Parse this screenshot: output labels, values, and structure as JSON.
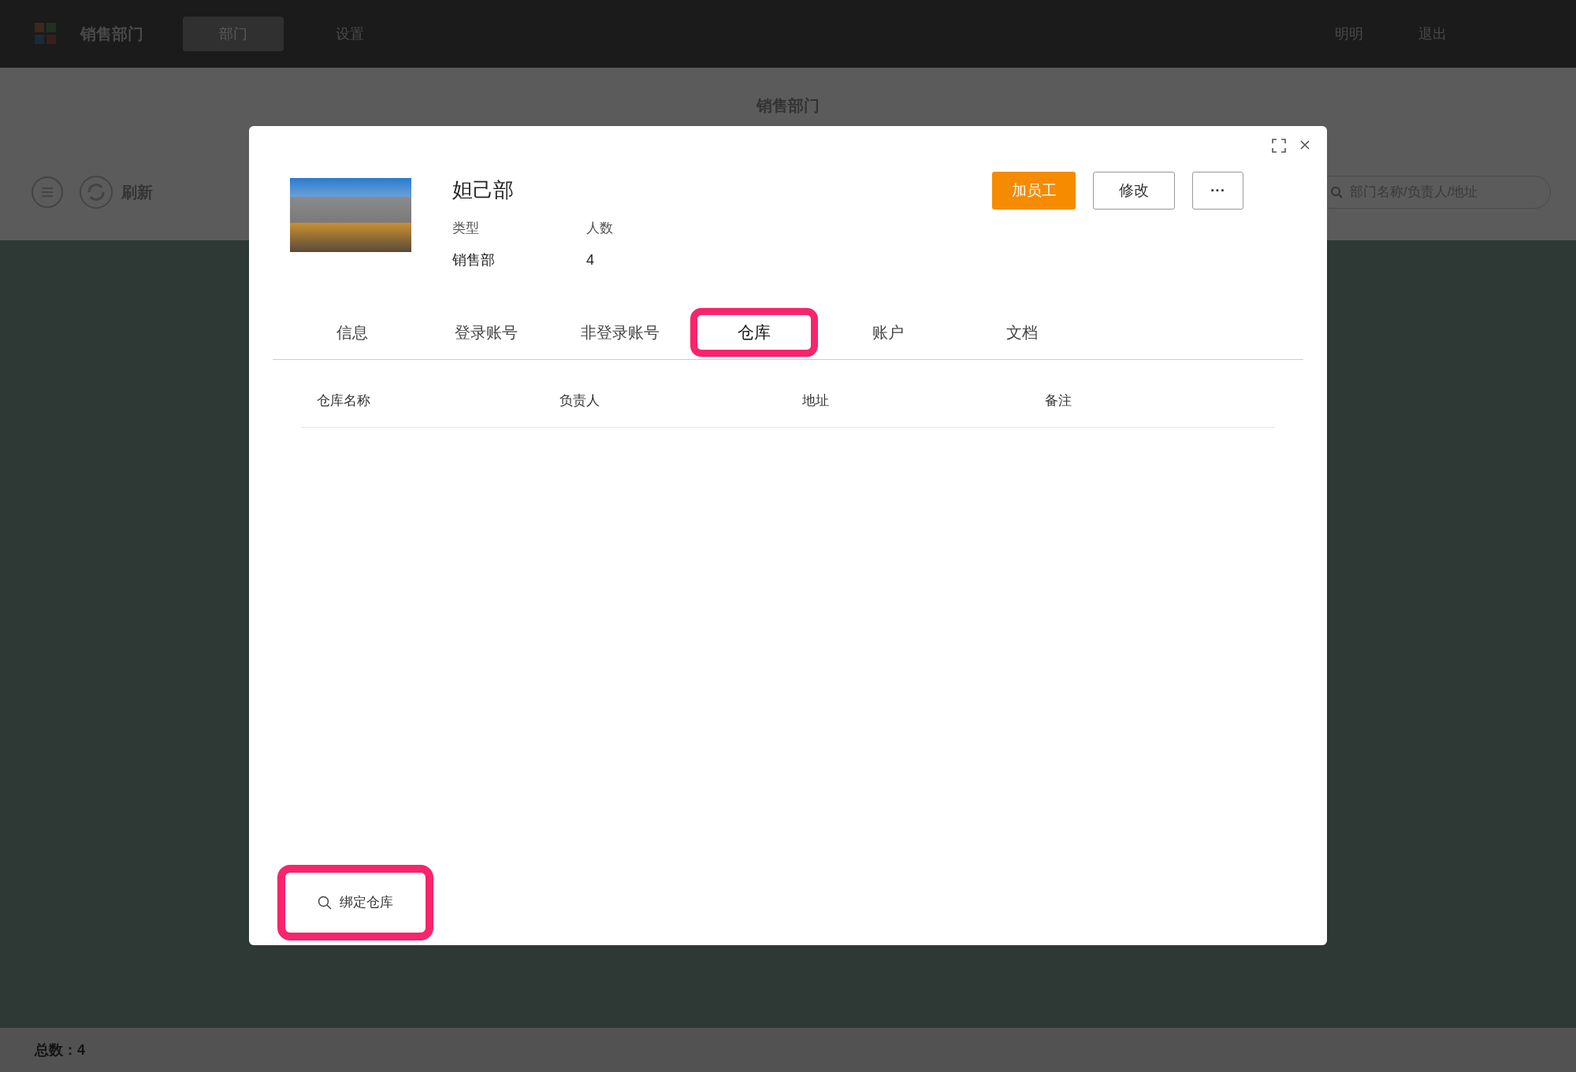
{
  "app_bar": {
    "title": "销售部门",
    "nav": [
      {
        "label": "部门",
        "selected": true
      },
      {
        "label": "设置",
        "selected": false
      }
    ],
    "user": "明明",
    "logout": "退出"
  },
  "page_header": {
    "title": "销售部门",
    "refresh": "刷新",
    "search": {
      "placeholder": "部门名称/负责人/地址"
    }
  },
  "footer": {
    "total": "总数：4"
  },
  "dialog": {
    "name": "妲己部",
    "fields": [
      {
        "label": "类型",
        "value": "销售部"
      },
      {
        "label": "人数",
        "value": "4"
      }
    ],
    "buttons": [
      {
        "label": "加员工",
        "kind": "primary"
      },
      {
        "label": "修改",
        "kind": "default"
      },
      {
        "label": "···",
        "kind": "more"
      }
    ],
    "tabs": [
      {
        "label": "信息",
        "selected": false
      },
      {
        "label": "登录账号",
        "selected": false
      },
      {
        "label": "非登录账号",
        "selected": false
      },
      {
        "label": "仓库",
        "selected": true
      },
      {
        "label": "账户",
        "selected": false
      },
      {
        "label": "文档",
        "selected": false
      }
    ],
    "table": {
      "columns": [
        "仓库名称",
        "负责人",
        "地址",
        "备注"
      ]
    },
    "bind_button": {
      "label": "绑定仓库",
      "highlighted": true
    }
  }
}
